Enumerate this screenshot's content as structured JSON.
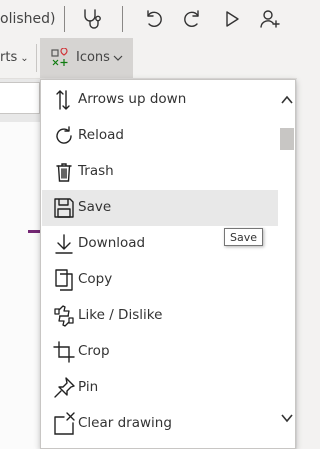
{
  "topbar": {
    "status_text": "olished)",
    "icons": [
      "stethoscope-icon",
      "undo-icon",
      "redo-icon",
      "play-icon",
      "add-user-icon"
    ]
  },
  "ribbon": {
    "parts_label": "rts",
    "icons_label": "Icons"
  },
  "menu": {
    "items": [
      {
        "label": "Arrows up down",
        "icon": "arrows-up-down-icon"
      },
      {
        "label": "Reload",
        "icon": "reload-icon"
      },
      {
        "label": "Trash",
        "icon": "trash-icon"
      },
      {
        "label": "Save",
        "icon": "save-icon",
        "selected": true
      },
      {
        "label": "Download",
        "icon": "download-icon"
      },
      {
        "label": "Copy",
        "icon": "copy-icon"
      },
      {
        "label": "Like / Dislike",
        "icon": "like-dislike-icon"
      },
      {
        "label": "Crop",
        "icon": "crop-icon"
      },
      {
        "label": "Pin",
        "icon": "pin-icon"
      },
      {
        "label": "Clear drawing",
        "icon": "clear-drawing-icon"
      }
    ]
  },
  "tooltip": {
    "text": "Save"
  },
  "colors": {
    "accent": "#742774",
    "selected_bg": "#e8e8e8",
    "toolbar_bg": "#f3f2f1"
  }
}
